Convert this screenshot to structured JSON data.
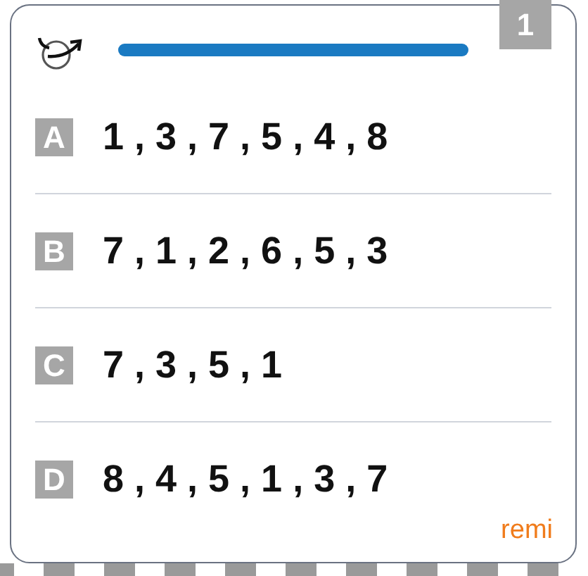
{
  "badge": "1",
  "timer": {
    "level": 1
  },
  "options": [
    {
      "letter": "A",
      "answer": "1 , 3 , 7 , 5 , 4 , 8"
    },
    {
      "letter": "B",
      "answer": "7 , 1 , 2 , 6 , 5 , 3"
    },
    {
      "letter": "C",
      "answer": "7 , 3 , 5 , 1"
    },
    {
      "letter": "D",
      "answer": "8 , 4 , 5 , 1 , 3 , 7"
    }
  ],
  "brand": "remi"
}
